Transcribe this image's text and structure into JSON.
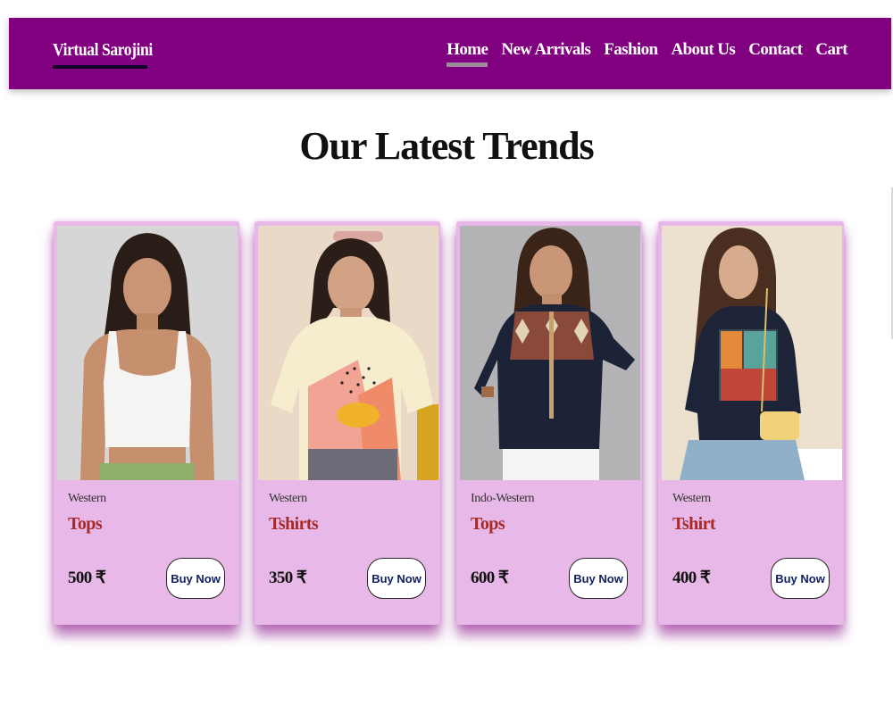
{
  "navbar": {
    "brand": "Virtual Sarojini",
    "links": [
      {
        "label": "Home",
        "active": true
      },
      {
        "label": "New Arrivals",
        "active": false
      },
      {
        "label": "Fashion",
        "active": false
      },
      {
        "label": "About Us",
        "active": false
      },
      {
        "label": "Contact",
        "active": false
      },
      {
        "label": "Cart",
        "active": false
      }
    ]
  },
  "section": {
    "title": "Our Latest Trends"
  },
  "products": [
    {
      "category": "Western",
      "name": "Tops",
      "price": "500 ₹",
      "button": "Buy Now"
    },
    {
      "category": "Western",
      "name": "Tshirts",
      "price": "350 ₹",
      "button": "Buy Now"
    },
    {
      "category": "Indo-Western",
      "name": "Tops",
      "price": "600 ₹",
      "button": "Buy Now"
    },
    {
      "category": "Western",
      "name": "Tshirt",
      "price": "400 ₹",
      "button": "Buy Now"
    }
  ],
  "colors": {
    "navbar_bg": "#800080",
    "card_bg": "#e8b9e8",
    "product_name": "#a52a2a",
    "button_text": "#102060"
  }
}
